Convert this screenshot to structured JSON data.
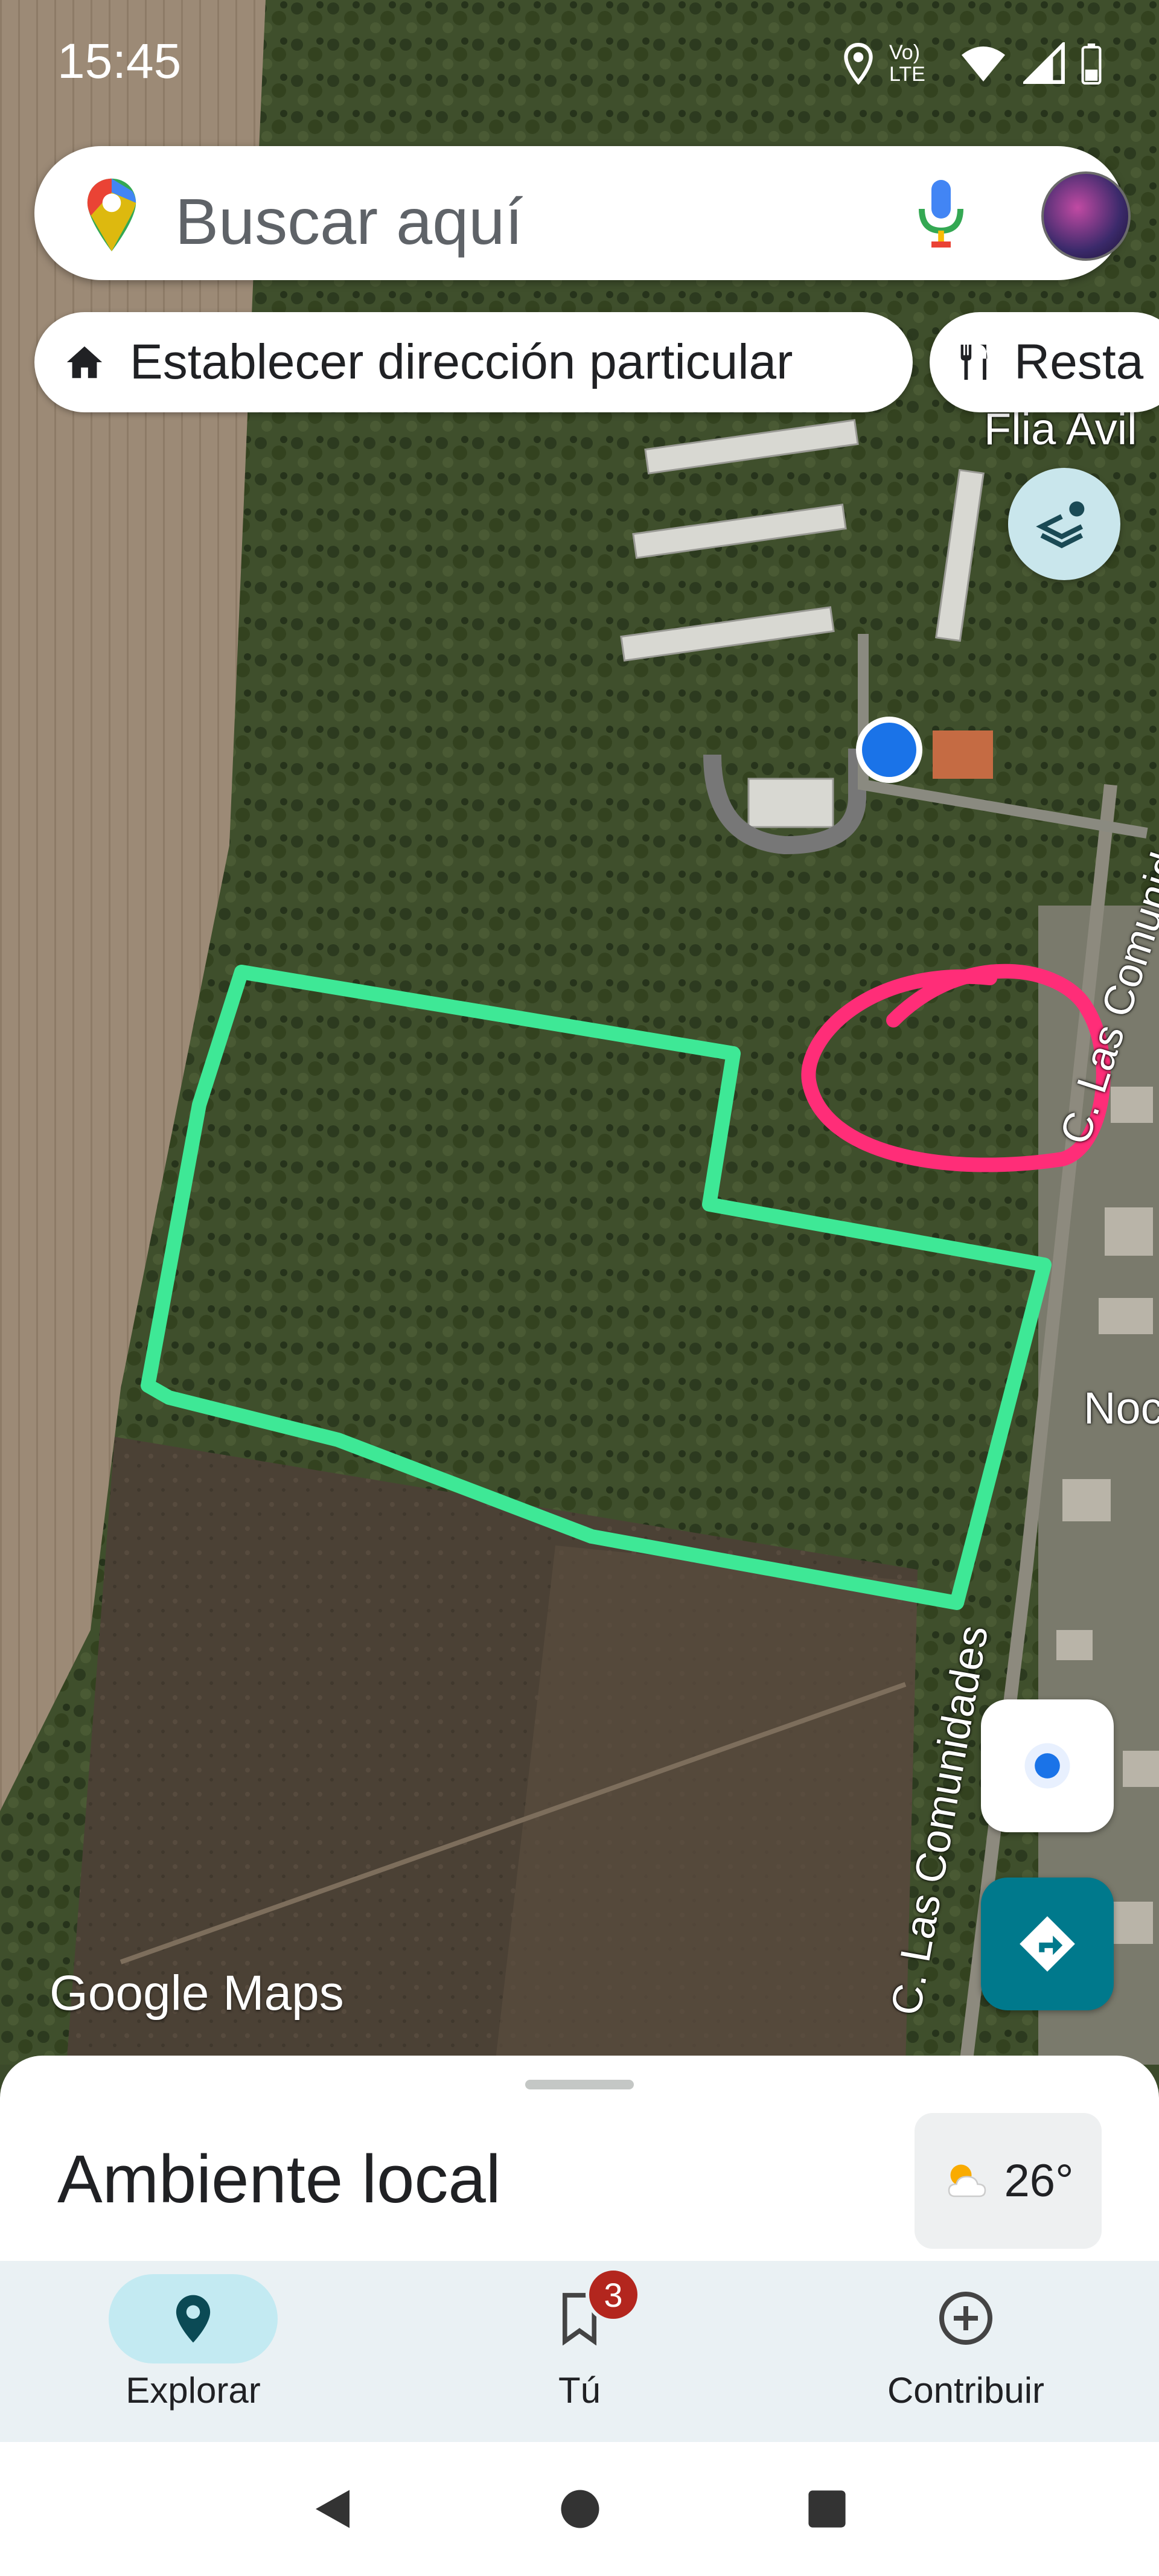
{
  "status_bar": {
    "time": "15:45",
    "network": "Vo) LTE"
  },
  "search": {
    "placeholder": "Buscar aquí"
  },
  "chips": [
    {
      "label": "Establecer dirección particular",
      "icon": "home-icon"
    },
    {
      "label": "Resta",
      "icon": "restaurant-icon"
    }
  ],
  "map": {
    "labels": {
      "poi": "Flia Avil",
      "street_right": "C. Las Comunidades",
      "street_bottom": "C. Las Comunidades",
      "partial_street": "Noc"
    },
    "watermark": "Google Maps",
    "annotation_colors": {
      "green_outline": "#3ee896",
      "pink_circle": "#ff2d78"
    }
  },
  "sheet": {
    "title": "Ambiente local",
    "weather": "26°"
  },
  "bottom_nav": {
    "items": [
      {
        "label": "Explorar",
        "icon": "explore-pin-icon",
        "active": true
      },
      {
        "label": "Tú",
        "icon": "bookmark-icon",
        "badge": "3"
      },
      {
        "label": "Contribuir",
        "icon": "add-circle-icon"
      }
    ]
  },
  "colors": {
    "accent": "#00798c",
    "active_pill": "#c3eaf2",
    "location_dot": "#1a73e8"
  }
}
